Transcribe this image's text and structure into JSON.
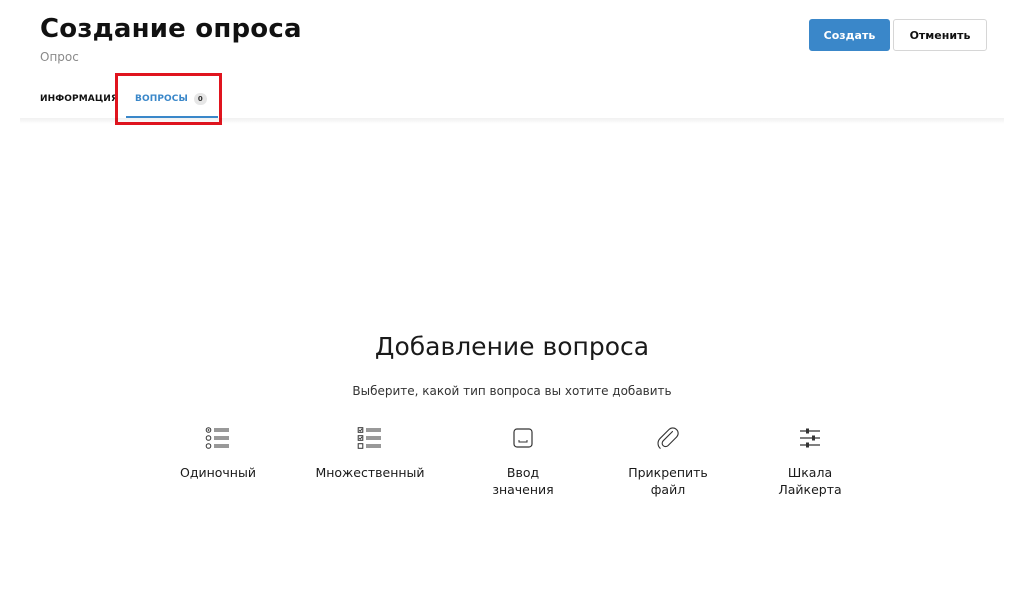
{
  "header": {
    "title": "Создание опроса",
    "subtitle": "Опрос",
    "create_label": "Создать",
    "cancel_label": "Отменить"
  },
  "tabs": [
    {
      "label": "ИНФОРМАЦИЯ",
      "active": false
    },
    {
      "label": "ВОПРОСЫ",
      "count": "0",
      "active": true
    }
  ],
  "empty_state": {
    "title": "Добавление вопроса",
    "hint": "Выберите, какой тип вопроса вы хотите добавить"
  },
  "question_types": [
    {
      "icon": "single-choice-icon",
      "label_lines": [
        "Одиночный"
      ]
    },
    {
      "icon": "multiple-choice-icon",
      "label_lines": [
        "Множественный"
      ]
    },
    {
      "icon": "text-input-icon",
      "label_lines": [
        "Ввод",
        "значения"
      ]
    },
    {
      "icon": "paperclip-icon",
      "label_lines": [
        "Прикрепить",
        "файл"
      ]
    },
    {
      "icon": "sliders-icon",
      "label_lines": [
        "Шкала",
        "Лайкерта"
      ]
    }
  ],
  "colors": {
    "accent": "#3a87c9",
    "highlight": "#e0141e"
  }
}
